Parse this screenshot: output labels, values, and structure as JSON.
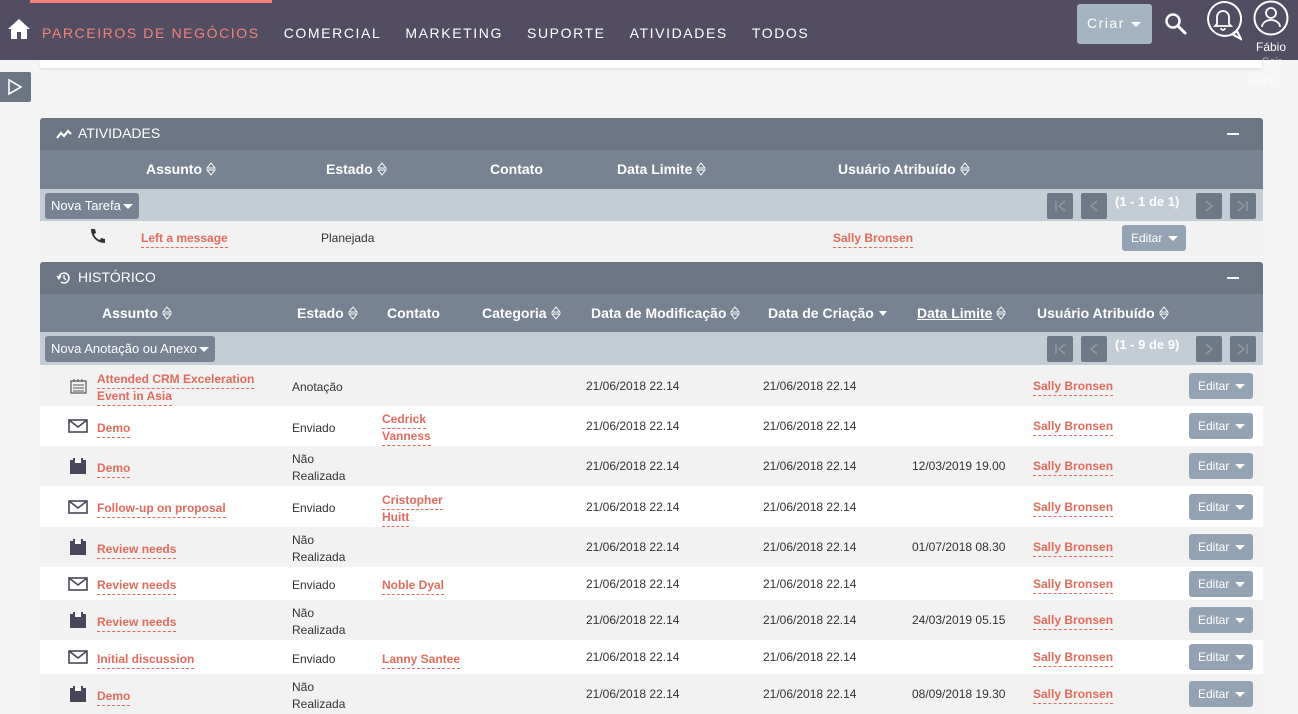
{
  "nav": {
    "items": [
      "PARCEIROS DE NEGÓCIOS",
      "COMERCIAL",
      "MARKETING",
      "SUPORTE",
      "ATIVIDADES",
      "TODOS"
    ],
    "create_label": "Criar",
    "user_name": "Fábio",
    "user_ghost_1": "Sair",
    "user_ghost_2": "Perfil"
  },
  "colors": {
    "topbar": "#534d64",
    "accent": "#f08377",
    "panel": "#6b7584",
    "link": "#e26b5c"
  },
  "activities": {
    "title": "ATIVIDADES",
    "columns": [
      "Assunto",
      "Estado",
      "Contato",
      "Data Limite",
      "Usuário Atribuído"
    ],
    "new_button": "Nova Tarefa",
    "pager": "(1 - 1 de 1)",
    "rows": [
      {
        "icon": "phone-icon",
        "subject": "Left a message",
        "status": "Planejada",
        "contact": "",
        "due": "",
        "assigned": "Sally Bronsen",
        "edit": "Editar"
      }
    ]
  },
  "history": {
    "title": "HISTÓRICO",
    "columns": [
      "Assunto",
      "Estado",
      "Contato",
      "Categoria",
      "Data de Modificação",
      "Data de Criação",
      "Data Limite",
      "Usuário Atribuído"
    ],
    "new_button": "Nova Anotação ou Anexo",
    "pager": "(1 - 9 de 9)",
    "rows": [
      {
        "icon": "note-icon",
        "subject": [
          "Attended CRM Exceleration",
          "Event in Asia"
        ],
        "status": [
          "Anotação"
        ],
        "contact": [],
        "modified": "21/06/2018 22.14",
        "created": "21/06/2018 22.14",
        "due": "",
        "assigned": "Sally Bronsen",
        "edit": "Editar"
      },
      {
        "icon": "email-icon",
        "subject": [
          "Demo"
        ],
        "status": [
          "Enviado"
        ],
        "contact": [
          "Cedrick",
          "Vanness"
        ],
        "modified": "21/06/2018 22.14",
        "created": "21/06/2018 22.14",
        "due": "",
        "assigned": "Sally Bronsen",
        "edit": "Editar"
      },
      {
        "icon": "meeting-icon",
        "subject": [
          "Demo"
        ],
        "status": [
          "Não",
          "Realizada"
        ],
        "contact": [],
        "modified": "21/06/2018 22.14",
        "created": "21/06/2018 22.14",
        "due": "12/03/2019 19.00",
        "assigned": "Sally Bronsen",
        "edit": "Editar"
      },
      {
        "icon": "email-icon",
        "subject": [
          "Follow-up on proposal"
        ],
        "status": [
          "Enviado"
        ],
        "contact": [
          "Cristopher",
          "Huitt"
        ],
        "modified": "21/06/2018 22.14",
        "created": "21/06/2018 22.14",
        "due": "",
        "assigned": "Sally Bronsen",
        "edit": "Editar"
      },
      {
        "icon": "meeting-icon",
        "subject": [
          "Review needs"
        ],
        "status": [
          "Não",
          "Realizada"
        ],
        "contact": [],
        "modified": "21/06/2018 22.14",
        "created": "21/06/2018 22.14",
        "due": "01/07/2018 08.30",
        "assigned": "Sally Bronsen",
        "edit": "Editar"
      },
      {
        "icon": "email-icon",
        "subject": [
          "Review needs"
        ],
        "status": [
          "Enviado"
        ],
        "contact": [
          "Noble Dyal"
        ],
        "modified": "21/06/2018 22.14",
        "created": "21/06/2018 22.14",
        "due": "",
        "assigned": "Sally Bronsen",
        "edit": "Editar"
      },
      {
        "icon": "meeting-icon",
        "subject": [
          "Review needs"
        ],
        "status": [
          "Não",
          "Realizada"
        ],
        "contact": [],
        "modified": "21/06/2018 22.14",
        "created": "21/06/2018 22.14",
        "due": "24/03/2019 05.15",
        "assigned": "Sally Bronsen",
        "edit": "Editar"
      },
      {
        "icon": "email-icon",
        "subject": [
          "Initial discussion"
        ],
        "status": [
          "Enviado"
        ],
        "contact": [
          "Lanny Santee"
        ],
        "modified": "21/06/2018 22.14",
        "created": "21/06/2018 22.14",
        "due": "",
        "assigned": "Sally Bronsen",
        "edit": "Editar"
      },
      {
        "icon": "meeting-icon",
        "subject": [
          "Demo"
        ],
        "status": [
          "Não",
          "Realizada"
        ],
        "contact": [],
        "modified": "21/06/2018 22.14",
        "created": "21/06/2018 22.14",
        "due": "08/09/2018 19.30",
        "assigned": "Sally Bronsen",
        "edit": "Editar"
      }
    ]
  }
}
